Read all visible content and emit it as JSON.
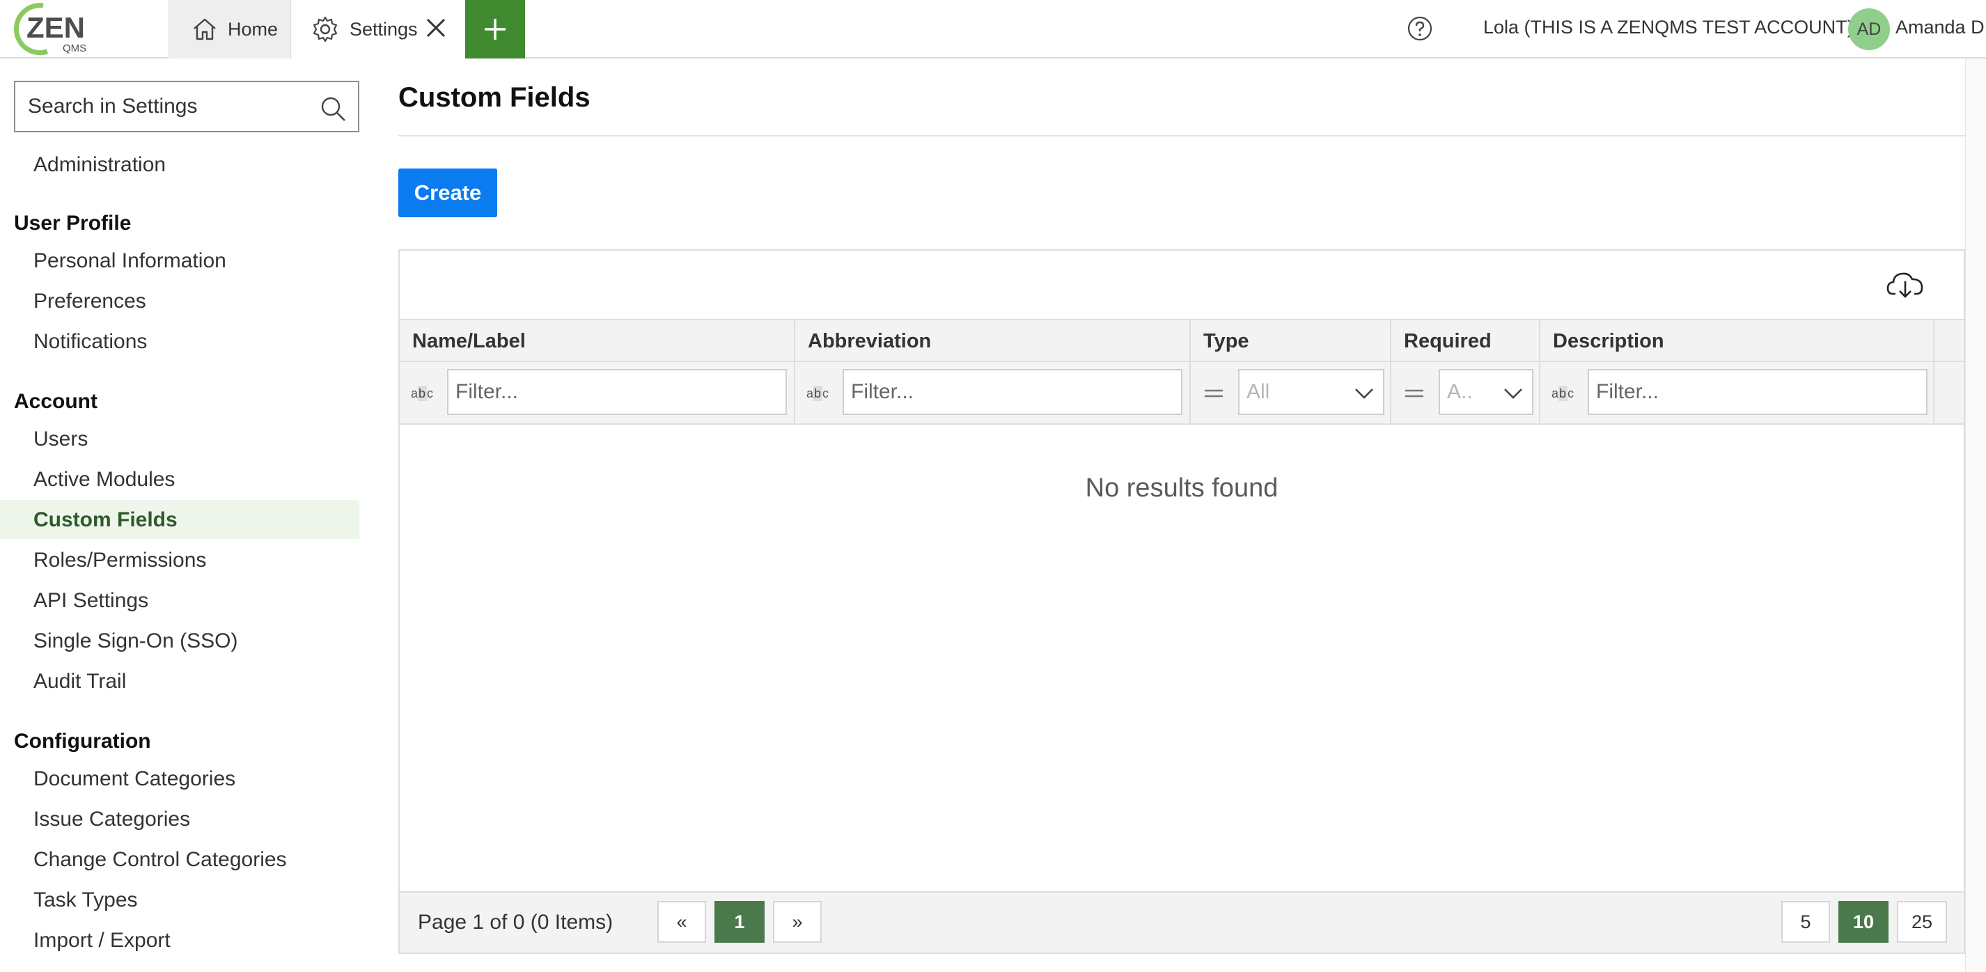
{
  "brand": {
    "logo_text": "ZEN",
    "logo_sub": "QMS",
    "accent": "#3f8a2e",
    "primary": "#0a7cf0"
  },
  "tabs": [
    {
      "label": "Home",
      "icon": "home-icon"
    },
    {
      "label": "Settings",
      "icon": "gear-icon",
      "close_icon": "close-icon"
    }
  ],
  "header": {
    "add_icon": "plus-icon",
    "help_icon": "help-icon",
    "account": "Lola (THIS IS A ZENQMS TEST ACCOUNT)",
    "avatar_initials": "AD",
    "user": "Amanda D"
  },
  "sidebar": {
    "search_placeholder": "Search in Settings",
    "items": {
      "administration": "Administration",
      "user_profile": "User Profile",
      "personal_information": "Personal Information",
      "preferences": "Preferences",
      "notifications": "Notifications",
      "account": "Account",
      "users": "Users",
      "active_modules": "Active Modules",
      "custom_fields": "Custom Fields",
      "roles_permissions": "Roles/Permissions",
      "api_settings": "API Settings",
      "sso": "Single Sign-On (SSO)",
      "audit_trail": "Audit Trail",
      "configuration": "Configuration",
      "document_categories": "Document Categories",
      "issue_categories": "Issue Categories",
      "change_control_categories": "Change Control Categories",
      "task_types": "Task Types",
      "import_export": "Import / Export"
    },
    "active": "Custom Fields"
  },
  "main": {
    "title": "Custom Fields",
    "create_label": "Create",
    "download_icon": "cloud-download-icon",
    "columns": [
      "Name/Label",
      "Abbreviation",
      "Type",
      "Required",
      "Description"
    ],
    "filters": {
      "name_placeholder": "Filter...",
      "abbr_placeholder": "Filter...",
      "type_value": "All",
      "required_value": "A..",
      "desc_placeholder": "Filter..."
    },
    "empty_text": "No results found",
    "pager": {
      "info": "Page 1 of 0 (0 Items)",
      "prev": "«",
      "current": "1",
      "next": "»",
      "sizes": [
        "5",
        "10",
        "25"
      ],
      "active_size": "10"
    }
  }
}
